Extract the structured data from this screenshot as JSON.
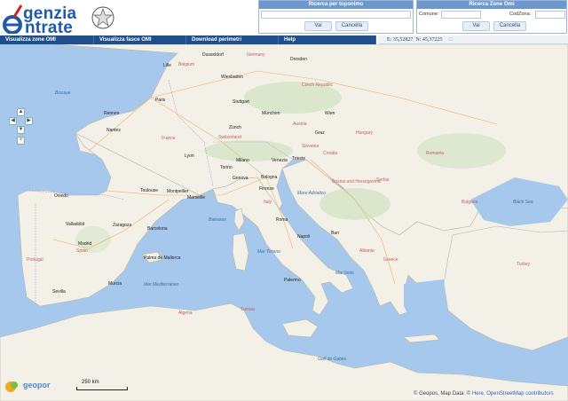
{
  "logo": {
    "line1": "genzia",
    "line2": "ntrate",
    "initial": "e"
  },
  "search_toponimo": {
    "title": "Ricerca per toponimo",
    "search_label": "Vai",
    "cancel_label": "Cancella",
    "value": ""
  },
  "search_zone": {
    "title": "Ricerca Zone Omi",
    "comune_label": "Comune:",
    "codzona_label": "CodZona:",
    "search_label": "Vai",
    "cancel_label": "Cancella",
    "comune_value": "",
    "codzona_value": ""
  },
  "menu": [
    {
      "label": "Visualizza zone OMI"
    },
    {
      "label": "Visualizza fasce OMI"
    },
    {
      "label": "Download perimetri"
    },
    {
      "label": "Help"
    }
  ],
  "coordinates": {
    "e": "E: 35,52827",
    "n": "N: 45,37225"
  },
  "map": {
    "cities": [
      "Dusseldorf",
      "Dresden",
      "Lille",
      "Wiesbaden",
      "Paris",
      "Stuttgart",
      "München",
      "Wien",
      "Rennes",
      "Nantes",
      "Zürich",
      "Graz",
      "Lyon",
      "Milano",
      "Venezia",
      "Trieste",
      "Torino",
      "Genova",
      "Bologna",
      "Toulouse",
      "Montpellier",
      "Marseille",
      "Firenze",
      "Oviedo",
      "Roma",
      "Valladolid",
      "Zaragoza",
      "Barcelona",
      "Madrid",
      "Napoli",
      "Bari",
      "Palma de Mallorca",
      "Murcia",
      "Sevilla",
      "Palermo"
    ],
    "countries": [
      "Belgium",
      "Germany",
      "Czech Republic",
      "France",
      "Switzerland",
      "Austria",
      "Hungary",
      "Slovenia",
      "Croatia",
      "Bosnia and Herzegovina",
      "Serbia",
      "Romania",
      "Italy",
      "Spain",
      "Greece",
      "Turkey",
      "Bulgaria",
      "Tunisia",
      "Algeria",
      "Portugal",
      "Albania"
    ],
    "seas": [
      "Biscaye",
      "Baleares",
      "Mar Tirreno",
      "Mar Ionio",
      "Mare Adriatico",
      "Mar Mediterraneo",
      "Black Sea",
      "Golf de Gabès"
    ],
    "scale_label": "250 km",
    "attribution_prefix": "© Geopos, Map Data: ©",
    "attribution_links": "Here, OpenStreetMap contributors",
    "provider_logo": "geopor"
  },
  "colors": {
    "header_blue": "#1e4f8d",
    "panel_blue": "#6d97cd",
    "sea": "#a6c8ec",
    "land": "#f3f0e8"
  }
}
